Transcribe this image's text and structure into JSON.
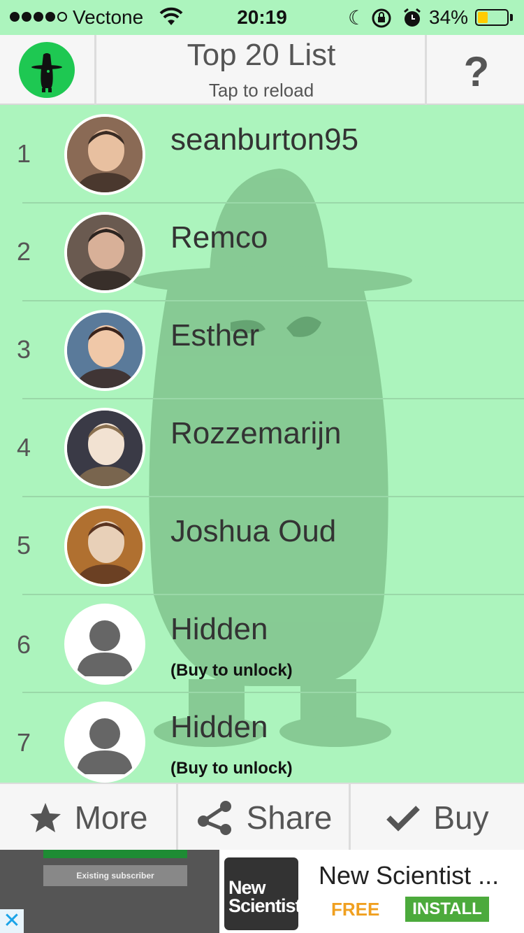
{
  "status_bar": {
    "signal_bars_filled": 4,
    "signal_bars_total": 5,
    "carrier": "Vectone",
    "time": "20:19",
    "battery_percent": "34%",
    "battery_level": 0.34,
    "icons": [
      "wifi-icon",
      "moon-icon",
      "rotation-lock-icon",
      "alarm-icon",
      "battery-icon"
    ]
  },
  "header": {
    "logo_icon": "spy-logo-icon",
    "title": "Top 20 List",
    "subtitle": "Tap to reload",
    "help_label": "?"
  },
  "list": {
    "rows": [
      {
        "rank": "1",
        "name": "seanburton95",
        "note": "",
        "avatar": "photo"
      },
      {
        "rank": "2",
        "name": "Remco",
        "note": "",
        "avatar": "photo"
      },
      {
        "rank": "3",
        "name": "Esther",
        "note": "",
        "avatar": "photo"
      },
      {
        "rank": "4",
        "name": "Rozzemarijn",
        "note": "",
        "avatar": "photo"
      },
      {
        "rank": "5",
        "name": "Joshua Oud",
        "note": "",
        "avatar": "photo"
      },
      {
        "rank": "6",
        "name": "Hidden",
        "note": "(Buy to unlock)",
        "avatar": "placeholder"
      },
      {
        "rank": "7",
        "name": "Hidden",
        "note": "(Buy to unlock)",
        "avatar": "placeholder"
      }
    ]
  },
  "toolbar": {
    "more_label": "More",
    "more_icon": "star-icon",
    "share_label": "Share",
    "share_icon": "share-icon",
    "buy_label": "Buy",
    "buy_icon": "checkmark-icon"
  },
  "ad": {
    "subscriber_label": "Existing subscriber",
    "close_glyph": "✕",
    "logo_line1": "New",
    "logo_line2": "Scientist",
    "title": "New Scientist ...",
    "price": "FREE",
    "install_label": "INSTALL"
  },
  "colors": {
    "background": "#acf4bd",
    "logo_green": "#1ec852",
    "header_bg": "#f6f6f6",
    "install_green": "#4caa3c",
    "free_orange": "#f0a020"
  }
}
